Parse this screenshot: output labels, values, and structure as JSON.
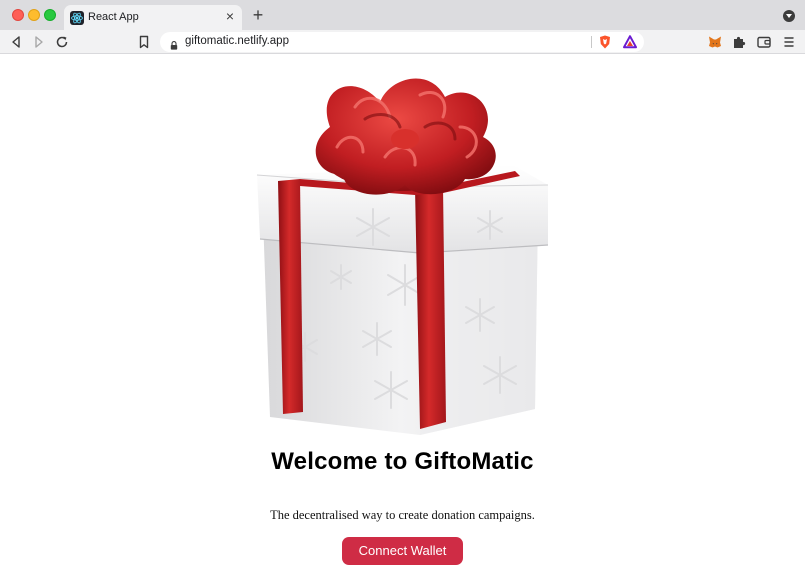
{
  "browser": {
    "tab": {
      "title": "React App",
      "close_glyph": "×"
    },
    "new_tab_glyph": "+",
    "url": "giftomatic.netlify.app",
    "icons": {
      "back": "back-arrow-icon",
      "forward": "forward-arrow-icon",
      "reload": "reload-icon",
      "bookmark": "bookmark-icon",
      "lock": "lock-icon",
      "brave_shields": "brave-shields-icon",
      "brave_rewards": "brave-rewards-icon",
      "metamask": "metamask-fox-icon",
      "extensions": "puzzle-icon",
      "wallet": "wallet-icon",
      "menu": "hamburger-icon"
    },
    "traffic_colors": {
      "close": "#fe5f57",
      "minimize": "#febc2e",
      "zoom": "#28c840"
    }
  },
  "page": {
    "image": "gift-box-with-red-bow",
    "heading": "Welcome to GiftoMatic",
    "tagline": "The decentralised way to create donation campaigns.",
    "connect_button": "Connect Wallet",
    "accent_color": "#cf2c45"
  }
}
